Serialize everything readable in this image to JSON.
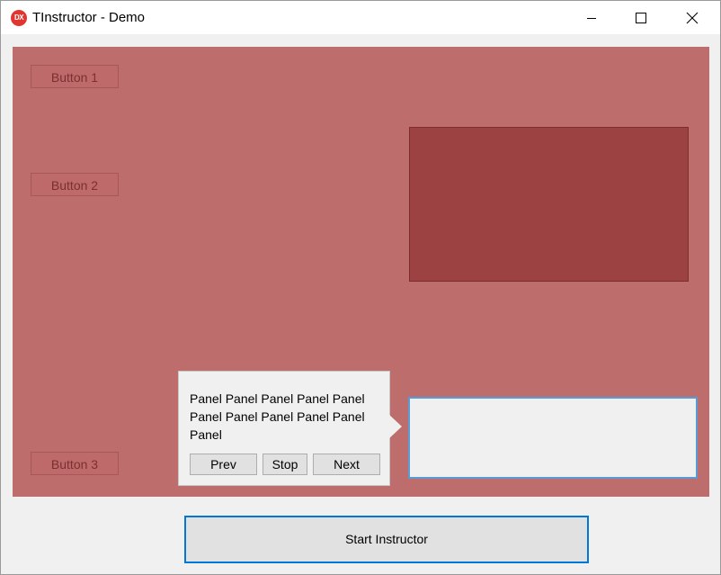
{
  "window": {
    "app_icon_text": "DX",
    "title": "TInstructor - Demo",
    "controls": {
      "minimize_icon": "minimize-icon",
      "maximize_icon": "maximize-icon",
      "close_icon": "close-icon"
    }
  },
  "form": {
    "buttons": [
      {
        "label": "Button 1"
      },
      {
        "label": "Button 2"
      },
      {
        "label": "Button 3"
      }
    ]
  },
  "callout": {
    "text": "Panel Panel Panel Panel Panel Panel Panel Panel Panel Panel Panel",
    "prev_label": "Prev",
    "stop_label": "Stop",
    "next_label": "Next"
  },
  "footer": {
    "start_label": "Start Instructor"
  },
  "colors": {
    "overlay": "#bc6d6c",
    "panel_dark": "#9c4242",
    "focus_border": "#5b9bd5",
    "accent": "#0078d7"
  }
}
